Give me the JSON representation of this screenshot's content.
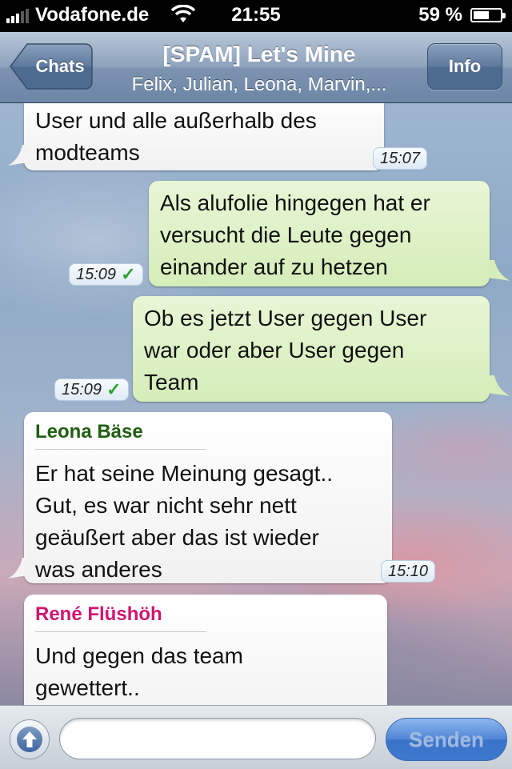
{
  "status_bar": {
    "carrier": "Vodafone.de",
    "time": "21:55",
    "battery_percent": "59 %",
    "battery_level": 0.59
  },
  "nav": {
    "back_label": "Chats",
    "title": "[SPAM] Let's Mine",
    "subtitle": "Felix, Julian, Leona, Marvin,...",
    "info_label": "Info"
  },
  "messages": [
    {
      "direction": "incoming",
      "text_lines": [
        "User und alle außerhalb des",
        "modteams"
      ],
      "time": "15:07"
    },
    {
      "direction": "outgoing",
      "text_lines": [
        "Als alufolie hingegen hat er",
        "versucht die Leute gegen",
        "einander auf zu hetzen"
      ],
      "time": "15:09",
      "delivered": true
    },
    {
      "direction": "outgoing",
      "text_lines": [
        "Ob es jetzt User gegen User",
        "war oder aber User gegen",
        "Team"
      ],
      "time": "15:09",
      "delivered": true
    },
    {
      "direction": "incoming",
      "sender": "Leona Bäse",
      "sender_color": "#1f5e10",
      "text_lines": [
        "Er hat seine Meinung gesagt..",
        "Gut, es war nicht sehr nett",
        "geäußert aber das ist wieder",
        "was anderes"
      ],
      "time": "15:10"
    },
    {
      "direction": "incoming",
      "sender": "René Flüshöh",
      "sender_color": "#d0156e",
      "text_lines": [
        "Und gegen das team",
        "gewettert.."
      ]
    }
  ],
  "input": {
    "placeholder": "",
    "send_label": "Senden"
  },
  "icons": {
    "attach": "arrow-up-circle-icon",
    "wifi": "wifi-icon",
    "signal": "signal-bars-icon",
    "battery": "battery-charging-icon",
    "check": "checkmark-icon"
  }
}
